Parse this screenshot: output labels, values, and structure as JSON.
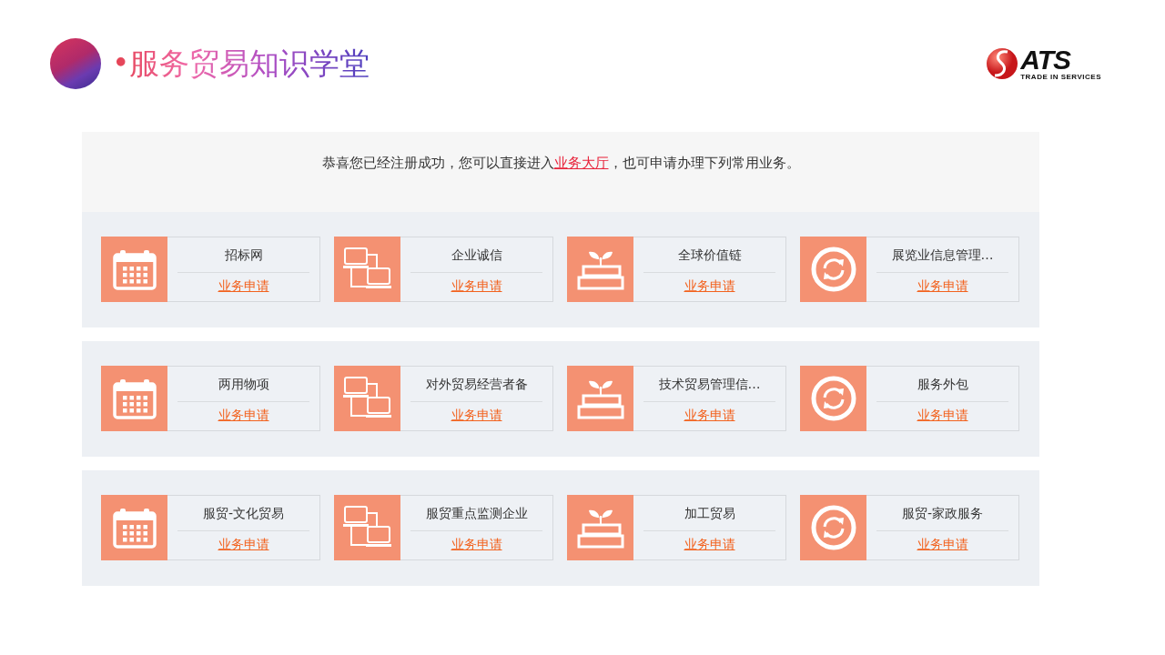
{
  "header": {
    "title": "•服务贸易知识学堂",
    "logo_text": "ATS",
    "logo_tagline": "TRADE IN SERVICES"
  },
  "intro": {
    "before": "恭喜您已经注册成功，您可以直接进入",
    "link": "业务大厅",
    "after": "，也可申请办理下列常用业务。"
  },
  "rows": [
    [
      {
        "kind": "calendar",
        "title": "招标网",
        "action": "业务申请"
      },
      {
        "kind": "computers",
        "title": "企业诚信",
        "action": "业务申请"
      },
      {
        "kind": "books",
        "title": "全球价值链",
        "action": "业务申请"
      },
      {
        "kind": "refresh",
        "title": "展览业信息管理…",
        "action": "业务申请"
      }
    ],
    [
      {
        "kind": "calendar",
        "title": "两用物项",
        "action": "业务申请"
      },
      {
        "kind": "computers",
        "title": "对外贸易经营者备",
        "action": "业务申请"
      },
      {
        "kind": "books",
        "title": "技术贸易管理信…",
        "action": "业务申请"
      },
      {
        "kind": "refresh",
        "title": "服务外包",
        "action": "业务申请"
      }
    ],
    [
      {
        "kind": "calendar",
        "title": "服贸-文化贸易",
        "action": "业务申请"
      },
      {
        "kind": "computers",
        "title": "服贸重点监测企业",
        "action": "业务申请"
      },
      {
        "kind": "books",
        "title": "加工贸易",
        "action": "业务申请"
      },
      {
        "kind": "refresh",
        "title": "服贸-家政服务",
        "action": "业务申请"
      }
    ]
  ]
}
